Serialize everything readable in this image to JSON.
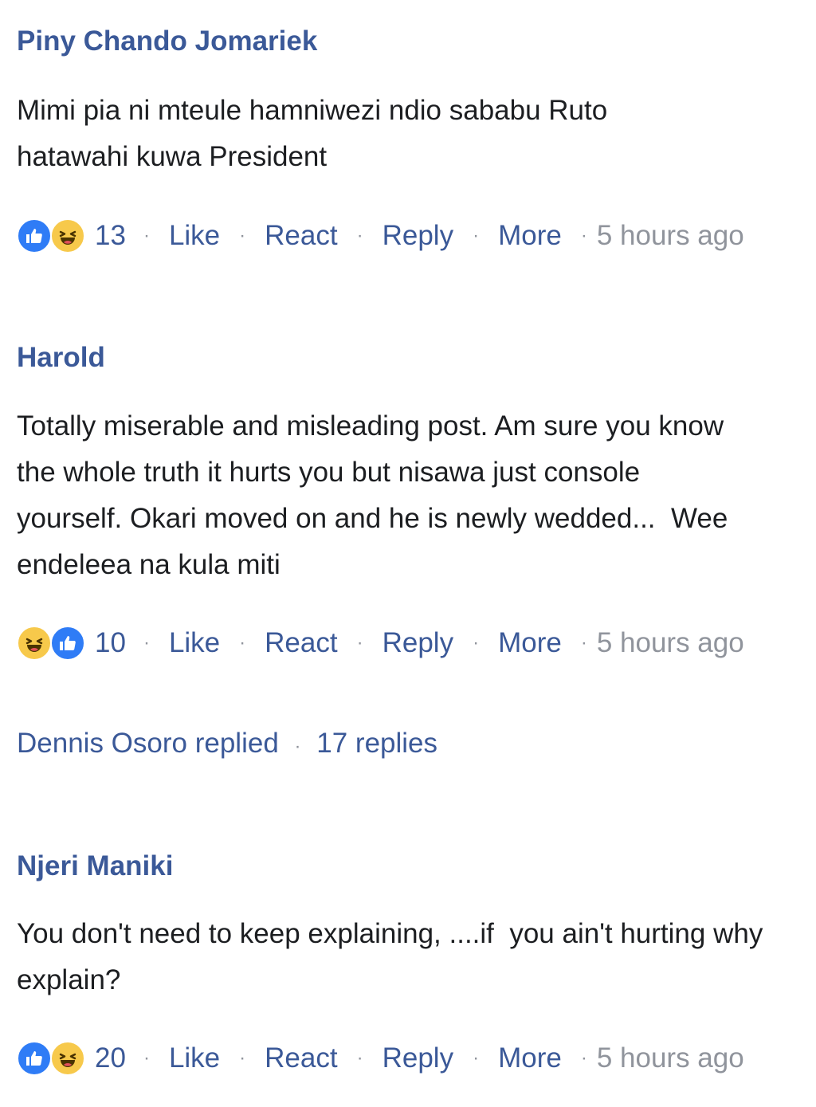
{
  "comments": [
    {
      "author": "Piny Chando Jomariek",
      "text": "Mimi pia ni mteule hamniwezi ndio sababu Ruto hatawahi kuwa President",
      "reactions": [
        "like",
        "haha"
      ],
      "count": "13",
      "time": "5 hours ago"
    },
    {
      "author": "Harold",
      "text": "Totally miserable and misleading post. Am sure you know the whole truth it hurts you but nisawa just console yourself. Okari moved on and he is newly wedded...  Wee endeleea na kula miti",
      "reactions": [
        "haha",
        "like"
      ],
      "count": "10",
      "time": "5 hours ago",
      "replies": {
        "replier": "Dennis Osoro",
        "replied_text": "replied",
        "count_text": "17 replies"
      }
    },
    {
      "author": "Njeri Maniki",
      "text": "You don't need to keep explaining, ....if  you ain't hurting why explain?",
      "reactions": [
        "like",
        "haha"
      ],
      "count": "20",
      "time": "5 hours ago"
    }
  ],
  "actions": {
    "like_label": "Like",
    "react_label": "React",
    "reply_label": "Reply",
    "more_label": "More",
    "separator": "·"
  },
  "colors": {
    "author": "#3b5998",
    "link": "#3b5998",
    "muted": "#90949c",
    "like_blue": "#2f7cf6",
    "haha_yellow": "#f7c94b"
  },
  "icons": {
    "like": "thumbs-up-icon",
    "haha": "laughing-face-icon"
  }
}
